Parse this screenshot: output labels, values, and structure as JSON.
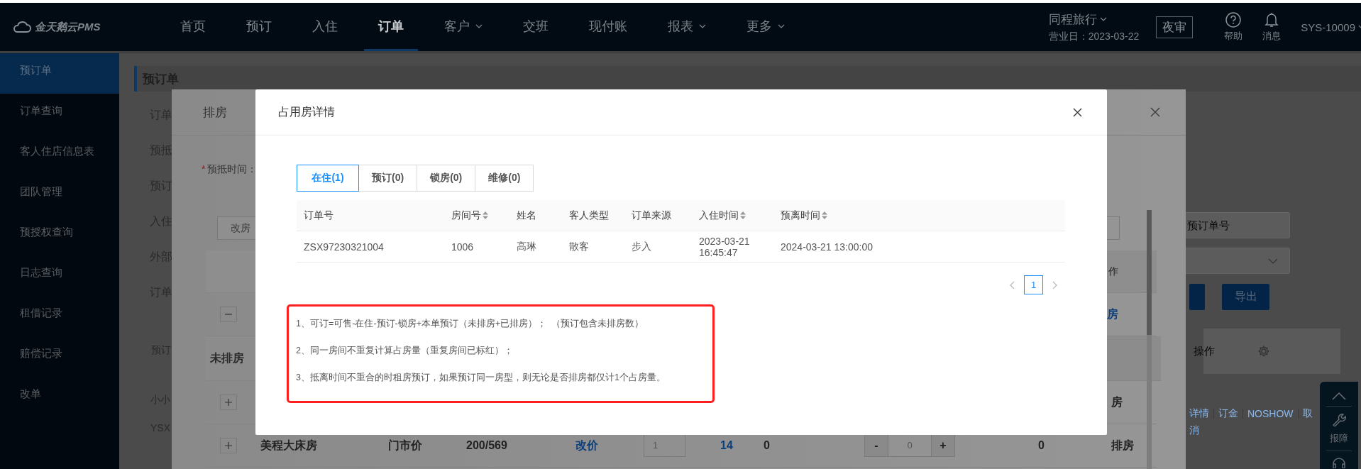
{
  "top_nav": {
    "logo": "金天鹅云PMS",
    "items": [
      {
        "label": "首页",
        "selected": false,
        "dropdown": false
      },
      {
        "label": "预订",
        "selected": false,
        "dropdown": false
      },
      {
        "label": "入住",
        "selected": false,
        "dropdown": false
      },
      {
        "label": "订单",
        "selected": true,
        "dropdown": false
      },
      {
        "label": "客户",
        "selected": false,
        "dropdown": true
      },
      {
        "label": "交班",
        "selected": false,
        "dropdown": false
      },
      {
        "label": "现付账",
        "selected": false,
        "dropdown": false
      },
      {
        "label": "报表",
        "selected": false,
        "dropdown": true
      },
      {
        "label": "更多",
        "selected": false,
        "dropdown": true
      }
    ],
    "hotel": "同程旅行",
    "business_date": "营业日：2023-03-22",
    "night_audit": "夜审",
    "help": "帮助",
    "messages": "消息",
    "user": "SYS-10009"
  },
  "sidebar": {
    "items": [
      {
        "label": "预订单",
        "selected": true
      },
      {
        "label": "订单查询",
        "selected": false
      },
      {
        "label": "客人住店信息表",
        "selected": false
      },
      {
        "label": "团队管理",
        "selected": false
      },
      {
        "label": "预授权查询",
        "selected": false
      },
      {
        "label": "日志查询",
        "selected": false
      },
      {
        "label": "租借记录",
        "selected": false
      },
      {
        "label": "赔偿记录",
        "selected": false
      },
      {
        "label": "改单",
        "selected": false
      }
    ]
  },
  "page": {
    "title": "预订单",
    "form_labels": [
      "订单",
      "预抵",
      "预订",
      "入住",
      "外部",
      "订单"
    ],
    "section_label": "预订",
    "list_texts": [
      "小小",
      "YSX"
    ],
    "order_search_placeholder": "预订单号",
    "export_button": "导出",
    "ops_label": "操作",
    "row_links": [
      "详情",
      "订金",
      "NOSHOW",
      "取"
    ],
    "row_link_wrap": "消"
  },
  "float_panel": {
    "report_label": "报障"
  },
  "assign_dialog": {
    "title": "排房",
    "required_mark": "*",
    "arrival_label": "预抵时间：",
    "change_price_button": "改房",
    "header_cell": "作",
    "group_expanded": true,
    "group_action": "房",
    "unassigned_label": "未排房",
    "rows": [
      {
        "expanded": false,
        "action": "房"
      },
      {
        "expanded": false,
        "room_type": "美程大床房",
        "price_type": "门市价",
        "price": "200/569",
        "change_price": "改价",
        "count": "1",
        "available": "14",
        "column_8": "0",
        "stepper_minus": "-",
        "stepper_value": "0",
        "stepper_plus": "+",
        "total": "0",
        "action": "排房"
      }
    ]
  },
  "occupancy_dialog": {
    "title": "占用房详情",
    "tabs": [
      {
        "label": "在住(1)",
        "selected": true
      },
      {
        "label": "预订(0)",
        "selected": false
      },
      {
        "label": "锁房(0)",
        "selected": false
      },
      {
        "label": "维修(0)",
        "selected": false
      }
    ],
    "columns": [
      {
        "label": "订单号",
        "sortable": false
      },
      {
        "label": "房间号",
        "sortable": true
      },
      {
        "label": "姓名",
        "sortable": false
      },
      {
        "label": "客人类型",
        "sortable": false
      },
      {
        "label": "订单来源",
        "sortable": false
      },
      {
        "label": "入住时间",
        "sortable": true
      },
      {
        "label": "预离时间",
        "sortable": true
      }
    ],
    "rows": [
      [
        "ZSX97230321004",
        "1006",
        "高琳",
        "散客",
        "步入",
        "2023-03-21 16:45:47",
        "2024-03-21 13:00:00"
      ]
    ],
    "pages": [
      {
        "label": "1",
        "selected": true
      }
    ],
    "notes": [
      "1、可订=可售-在住-预订-锁房+本单预订（未排房+已排房）；  （预订包含未排房数）",
      "2、同一房间不重复计算占房量（重复房间已标红）；",
      "3、抵离时间不重合的时租房预订，如果预订同一房型，则无论是否排房都仅计1个占房量。"
    ]
  }
}
